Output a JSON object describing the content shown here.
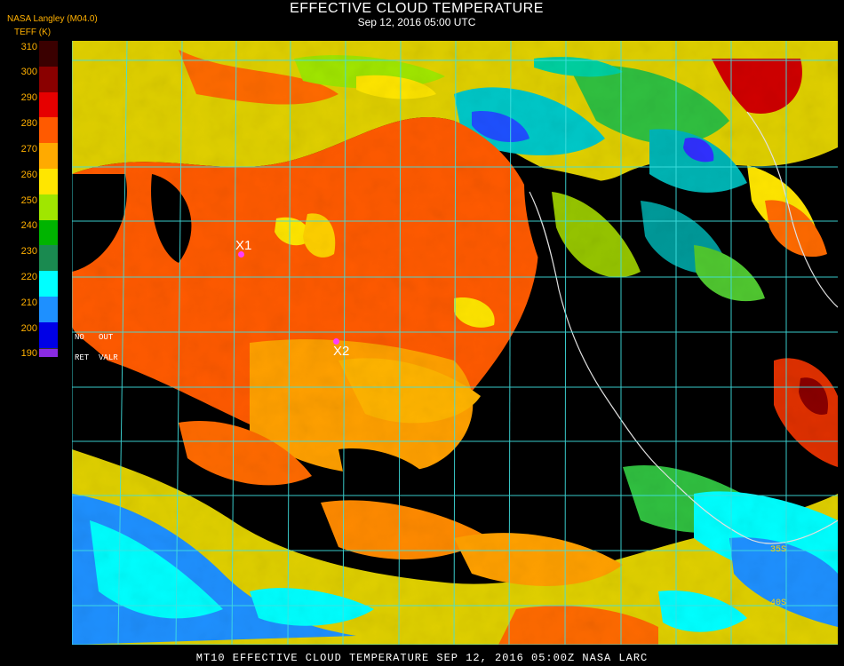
{
  "header": {
    "title": "EFFECTIVE CLOUD TEMPERATURE",
    "subtitle": "Sep 12, 2016 05:00 UTC",
    "agency": "NASA Langley (M04.0)",
    "units": "TEFF (K)"
  },
  "legend": {
    "ticks": [
      "310",
      "300",
      "290",
      "280",
      "270",
      "260",
      "250",
      "240",
      "230",
      "220",
      "210",
      "200",
      "190"
    ],
    "colors": [
      "#3a0000",
      "#8a0000",
      "#e60000",
      "#ff5a00",
      "#ffaa00",
      "#ffe600",
      "#a0e600",
      "#00b400",
      "#1a8a50",
      "#00ffff",
      "#1e90ff",
      "#0000e6",
      "#8a2be2"
    ],
    "flag_row1": [
      "NO",
      "OUT"
    ],
    "flag_row2": [
      "RET",
      "VALR"
    ]
  },
  "map": {
    "markers": [
      {
        "label": "X1"
      },
      {
        "label": "X2"
      }
    ],
    "grid_labels": [
      "35S",
      "40S"
    ]
  },
  "footer": {
    "text": "MT10  EFFECTIVE CLOUD TEMPERATURE   SEP 12, 2016 05:00Z   NASA LARC"
  }
}
